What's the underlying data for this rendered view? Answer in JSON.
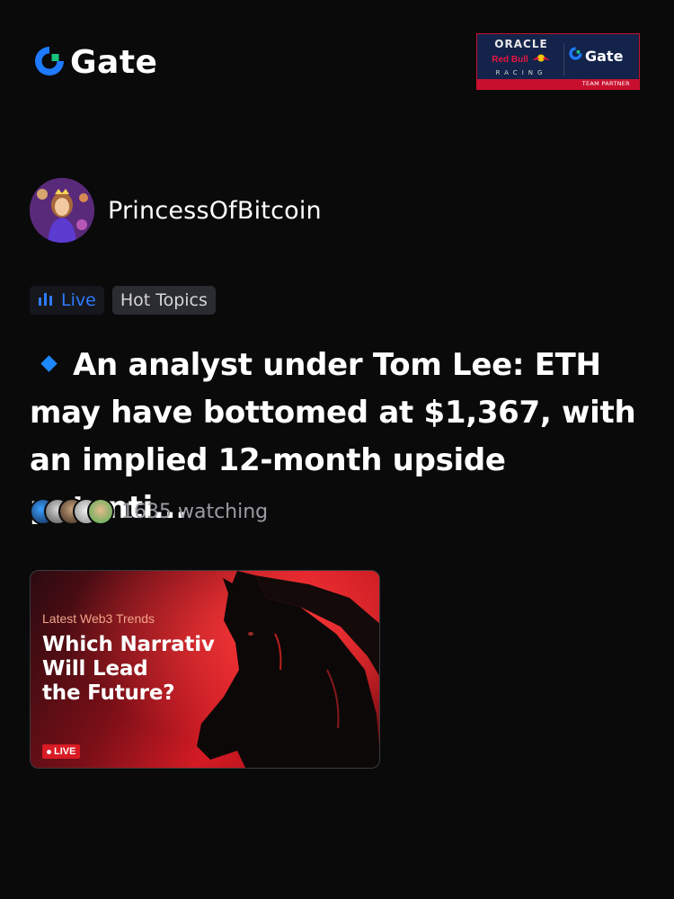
{
  "header": {
    "logo_text": "Gate",
    "logo_icon": "gate-logo-icon",
    "partner": {
      "oracle": "ORACLE",
      "redbull": "Red Bull",
      "racing": "RACING",
      "gate": "Gate",
      "strip": "TEAM PARTNER"
    }
  },
  "author": {
    "name": "PrincessOfBitcoin",
    "avatar_icon": "avatar"
  },
  "tags": {
    "live": "Live",
    "topic": "Hot Topics"
  },
  "headline": "An analyst under Tom Lee: ETH may have bottomed at $1,367, with an implied 12-month upside potenti...",
  "watching": {
    "count_text": "1635 watching",
    "avatar_count": 5
  },
  "card": {
    "kicker": "Latest Web3 Trends",
    "title": "Which Narrativ\nWill Lead\nthe Future?",
    "live_badge": "LIVE"
  },
  "colors": {
    "background": "#0a0a0b",
    "accent_blue": "#2f7bff",
    "brand_red": "#d81b24"
  }
}
